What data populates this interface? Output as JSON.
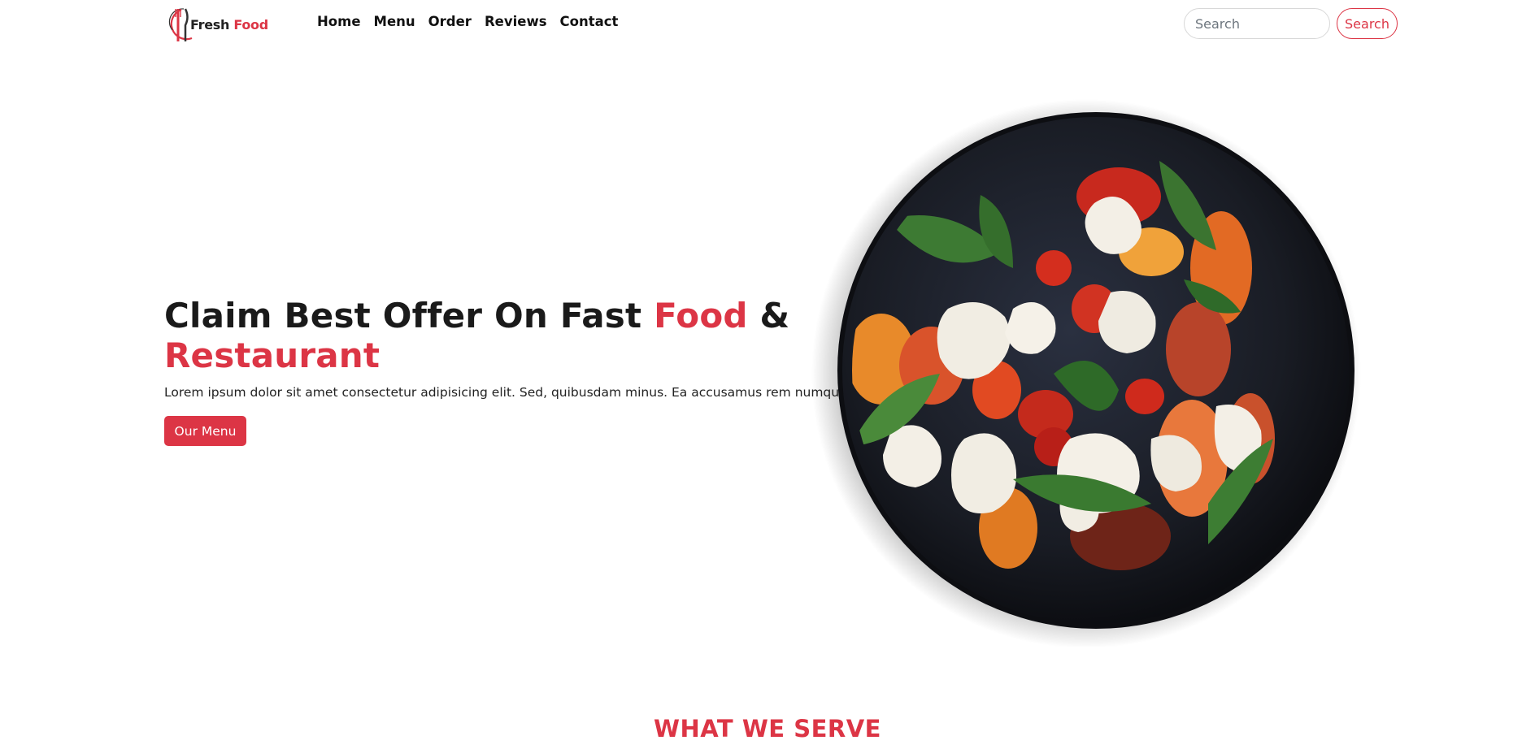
{
  "brand": {
    "name_part1": "Fresh",
    "name_part2": "Food",
    "accent_color": "#dc3545",
    "logo_icon": "fork-knife-logo"
  },
  "nav": {
    "items": [
      {
        "label": "Home"
      },
      {
        "label": "Menu"
      },
      {
        "label": "Order"
      },
      {
        "label": "Reviews"
      },
      {
        "label": "Contact"
      }
    ]
  },
  "search": {
    "placeholder": "Search",
    "button_label": "Search"
  },
  "hero": {
    "title_part1": "Claim Best Offer On Fast ",
    "title_highlight1": "Food",
    "title_part2": " & ",
    "title_highlight2": "Restaurant",
    "description": "Lorem ipsum dolor sit amet consectetur adipisicing elit. Sed, quibusdam minus. Ea accusamus rem numquam.",
    "button_label": "Our Menu",
    "image": "salad-plate-image"
  },
  "section": {
    "heading": "WHAT WE SERVE"
  }
}
